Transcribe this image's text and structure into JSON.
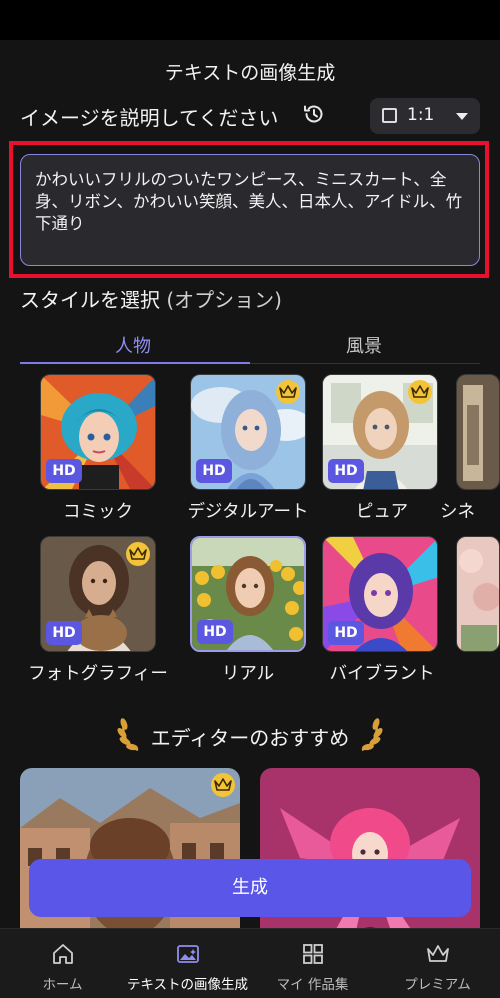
{
  "header": {
    "title": "テキストの画像生成"
  },
  "prompt": {
    "label": "イメージを説明してください",
    "history_icon": "history-icon",
    "ratio": "1:1",
    "text": "かわいいフリルのついたワンピース、ミニスカート、全身、リボン、かわいい笑顔、美人、日本人、アイドル、竹下通り"
  },
  "style": {
    "heading": "スタイルを選択",
    "heading_optional": "(オプション)",
    "tabs": [
      {
        "label": "人物"
      },
      {
        "label": "風景"
      }
    ],
    "hd_badge": "HD",
    "items": [
      {
        "label": "コミック",
        "premium": false
      },
      {
        "label": "デジタルアート",
        "premium": true
      },
      {
        "label": "ピュア",
        "premium": true
      },
      {
        "label": "シネ",
        "premium": false
      },
      {
        "label": "フォトグラフィー",
        "premium": true
      },
      {
        "label": "リアル",
        "premium": false
      },
      {
        "label": "バイブラント",
        "premium": false
      }
    ]
  },
  "editor": {
    "title": "エディターのおすすめ"
  },
  "generate": {
    "label": "生成"
  },
  "nav": {
    "items": [
      {
        "label": "ホーム",
        "icon": "home-icon"
      },
      {
        "label": "テキストの画像生成",
        "icon": "image-gen-icon"
      },
      {
        "label": "マイ 作品集",
        "icon": "grid-icon"
      },
      {
        "label": "プレミアム",
        "icon": "crown-icon"
      }
    ]
  },
  "colors": {
    "accent": "#5a56e8",
    "tab_active": "#8f8df0",
    "highlight": "#e8112d",
    "premium": "#f3c43a"
  }
}
